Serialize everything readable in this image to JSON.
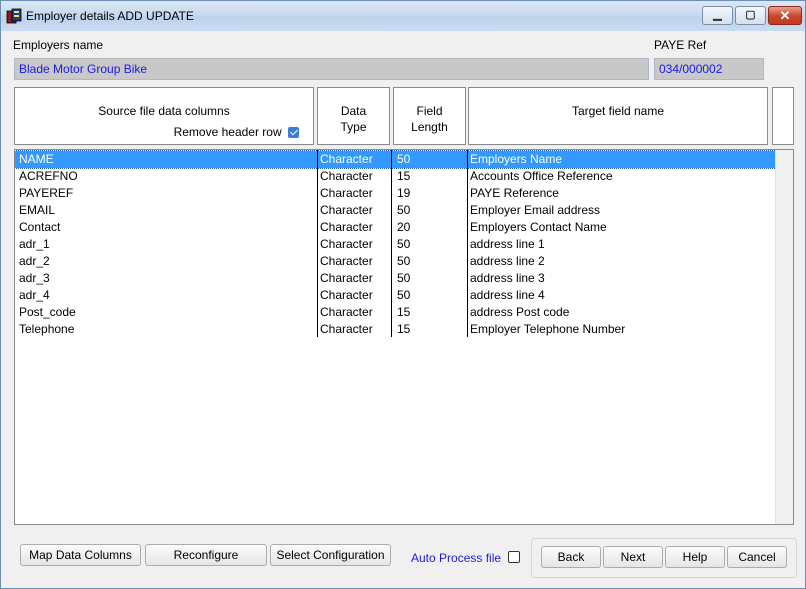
{
  "window": {
    "title": "Employer details ADD UPDATE",
    "controls": [
      "minimize",
      "maximize",
      "close"
    ]
  },
  "employer": {
    "name_label": "Employers name",
    "name_value": "Blade Motor Group Bike",
    "paye_label": "PAYE Ref",
    "paye_value": "034/000002"
  },
  "grid_header": {
    "source_label": "Source file data columns",
    "remove_header_label": "Remove header row",
    "remove_header_checked": true,
    "data_type_label_1": "Data",
    "data_type_label_2": "Type",
    "field_length_label_1": "Field",
    "field_length_label_2": "Length",
    "target_label": "Target field name"
  },
  "rows": [
    {
      "source": "NAME",
      "type": "Character",
      "length": "50",
      "target": "Employers Name",
      "selected": true
    },
    {
      "source": "ACREFNO",
      "type": "Character",
      "length": "15",
      "target": "Accounts Office Reference"
    },
    {
      "source": "PAYEREF",
      "type": "Character",
      "length": "19",
      "target": "PAYE Reference"
    },
    {
      "source": "EMAIL",
      "type": "Character",
      "length": "50",
      "target": "Employer Email address"
    },
    {
      "source": "Contact",
      "type": "Character",
      "length": "20",
      "target": "Employers Contact Name"
    },
    {
      "source": "adr_1",
      "type": "Character",
      "length": "50",
      "target": "address line 1"
    },
    {
      "source": "adr_2",
      "type": "Character",
      "length": "50",
      "target": "address line 2"
    },
    {
      "source": "adr_3",
      "type": "Character",
      "length": "50",
      "target": "address line 3"
    },
    {
      "source": "adr_4",
      "type": "Character",
      "length": "50",
      "target": "address line 4"
    },
    {
      "source": "Post_code",
      "type": "Character",
      "length": "15",
      "target": "address Post code"
    },
    {
      "source": "Telephone",
      "type": "Character",
      "length": "15",
      "target": "Employer Telephone Number"
    }
  ],
  "buttons": {
    "map_data_columns": "Map Data Columns",
    "reconfigure": "Reconfigure",
    "select_configuration": "Select Configuration",
    "auto_process_label": "Auto Process file",
    "auto_process_checked": false,
    "back": "Back",
    "next": "Next",
    "help": "Help",
    "cancel": "Cancel"
  },
  "colors": {
    "selection": "#3399ff",
    "field_text": "#1a1ae6",
    "field_bg": "#c8c8c8"
  }
}
